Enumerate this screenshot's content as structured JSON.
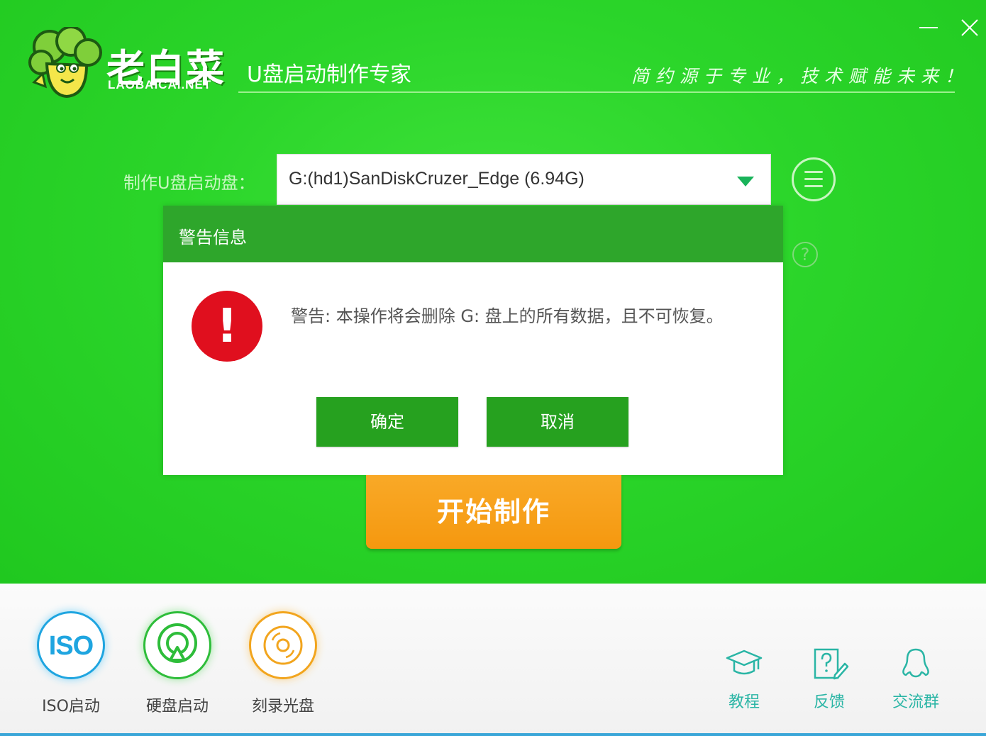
{
  "header": {
    "brand_cn": "老白菜",
    "brand_en": "LAOBAICAI.NET",
    "subtitle": "U盘启动制作专家",
    "slogan": "简约源于专业，技术赋能未来！",
    "minimize_label": "—",
    "close_label": "✕"
  },
  "device": {
    "label": "制作U盘启动盘：",
    "selected": "G:(hd1)SanDiskCruzer_Edge (6.94G)"
  },
  "dialog": {
    "title": "警告信息",
    "icon_symbol": "!",
    "message": "警告: 本操作将会删除 G: 盘上的所有数据，且不可恢复。",
    "ok_label": "确定",
    "cancel_label": "取消"
  },
  "start_button": "开始制作",
  "help_symbol": "?",
  "tools": {
    "iso": {
      "icon_text": "ISO",
      "label": "ISO启动"
    },
    "hdd": {
      "label": "硬盘启动"
    },
    "cd": {
      "label": "刻录光盘"
    }
  },
  "links": {
    "tutorial": "教程",
    "feedback": "反馈",
    "group": "交流群"
  },
  "colors": {
    "green_bg": "#2bd52a",
    "dialog_title": "#2ea62b",
    "button_green": "#26a11f",
    "start_orange": "#f5980f",
    "warning_red": "#e00f1e"
  }
}
